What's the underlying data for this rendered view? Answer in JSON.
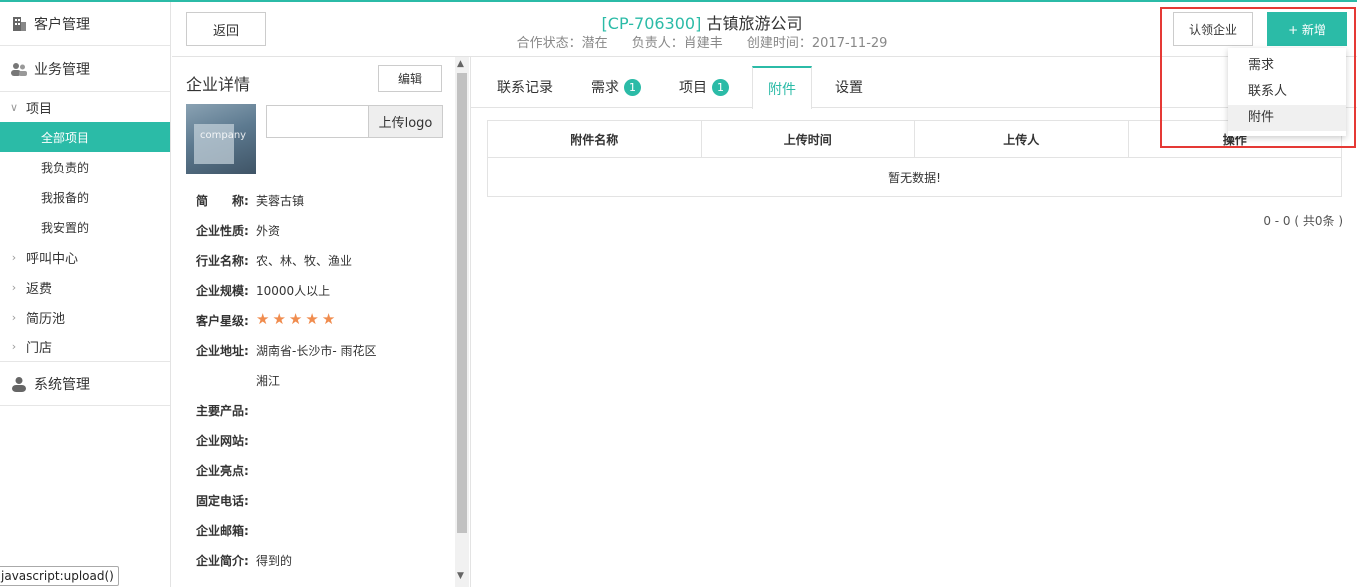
{
  "sidebar": {
    "customer_mgmt": "客户管理",
    "business_mgmt": "业务管理",
    "project": "项目",
    "project_items": [
      "全部项目",
      "我负责的",
      "我报备的",
      "我安置的"
    ],
    "call_center": "呼叫中心",
    "rebate": "返费",
    "resume_pool": "简历池",
    "store": "门店",
    "system_mgmt": "系统管理"
  },
  "status_tooltip": "javascript:upload()",
  "header": {
    "back_label": "返回",
    "code": "[CP-706300]",
    "company_name": "古镇旅游公司",
    "status": "合作状态：潜在",
    "owner": "负责人：肖建丰",
    "created": "创建时间：2017-11-29",
    "claim_label": "认领企业",
    "add_label": "+ 新增"
  },
  "add_menu": [
    "需求",
    "联系人",
    "附件"
  ],
  "detail": {
    "title": "企业详情",
    "edit_label": "编辑",
    "upload_logo_label": "上传logo",
    "logo_text": "company",
    "fields": [
      {
        "label": "简　　称:",
        "value": "芙蓉古镇"
      },
      {
        "label": "企业性质:",
        "value": "外资"
      },
      {
        "label": "行业名称:",
        "value": "农、林、牧、渔业"
      },
      {
        "label": "企业规模:",
        "value": "10000人以上"
      },
      {
        "label": "客户星级:",
        "value": ""
      },
      {
        "label": "企业地址:",
        "value": "湖南省-长沙市- 雨花区"
      },
      {
        "label": "",
        "value": "湘江"
      },
      {
        "label": "主要产品:",
        "value": ""
      },
      {
        "label": "企业网站:",
        "value": ""
      },
      {
        "label": "企业亮点:",
        "value": ""
      },
      {
        "label": "固定电话:",
        "value": ""
      },
      {
        "label": "企业邮箱:",
        "value": ""
      },
      {
        "label": "企业简介:",
        "value": "得到的"
      }
    ],
    "star_rating": 5
  },
  "tabs": [
    {
      "label": "联系记录",
      "badge": ""
    },
    {
      "label": "需求",
      "badge": "1"
    },
    {
      "label": "项目",
      "badge": "1"
    },
    {
      "label": "附件",
      "badge": ""
    },
    {
      "label": "设置",
      "badge": ""
    }
  ],
  "table": {
    "headers": [
      "附件名称",
      "上传时间",
      "上传人",
      "操作"
    ],
    "empty_text": "暂无数据!"
  },
  "pager_text": "0 - 0 ( 共0条 )",
  "colors": {
    "accent": "#2bbba7",
    "highlight_box": "#e53935",
    "stars": "#f08c4e"
  }
}
